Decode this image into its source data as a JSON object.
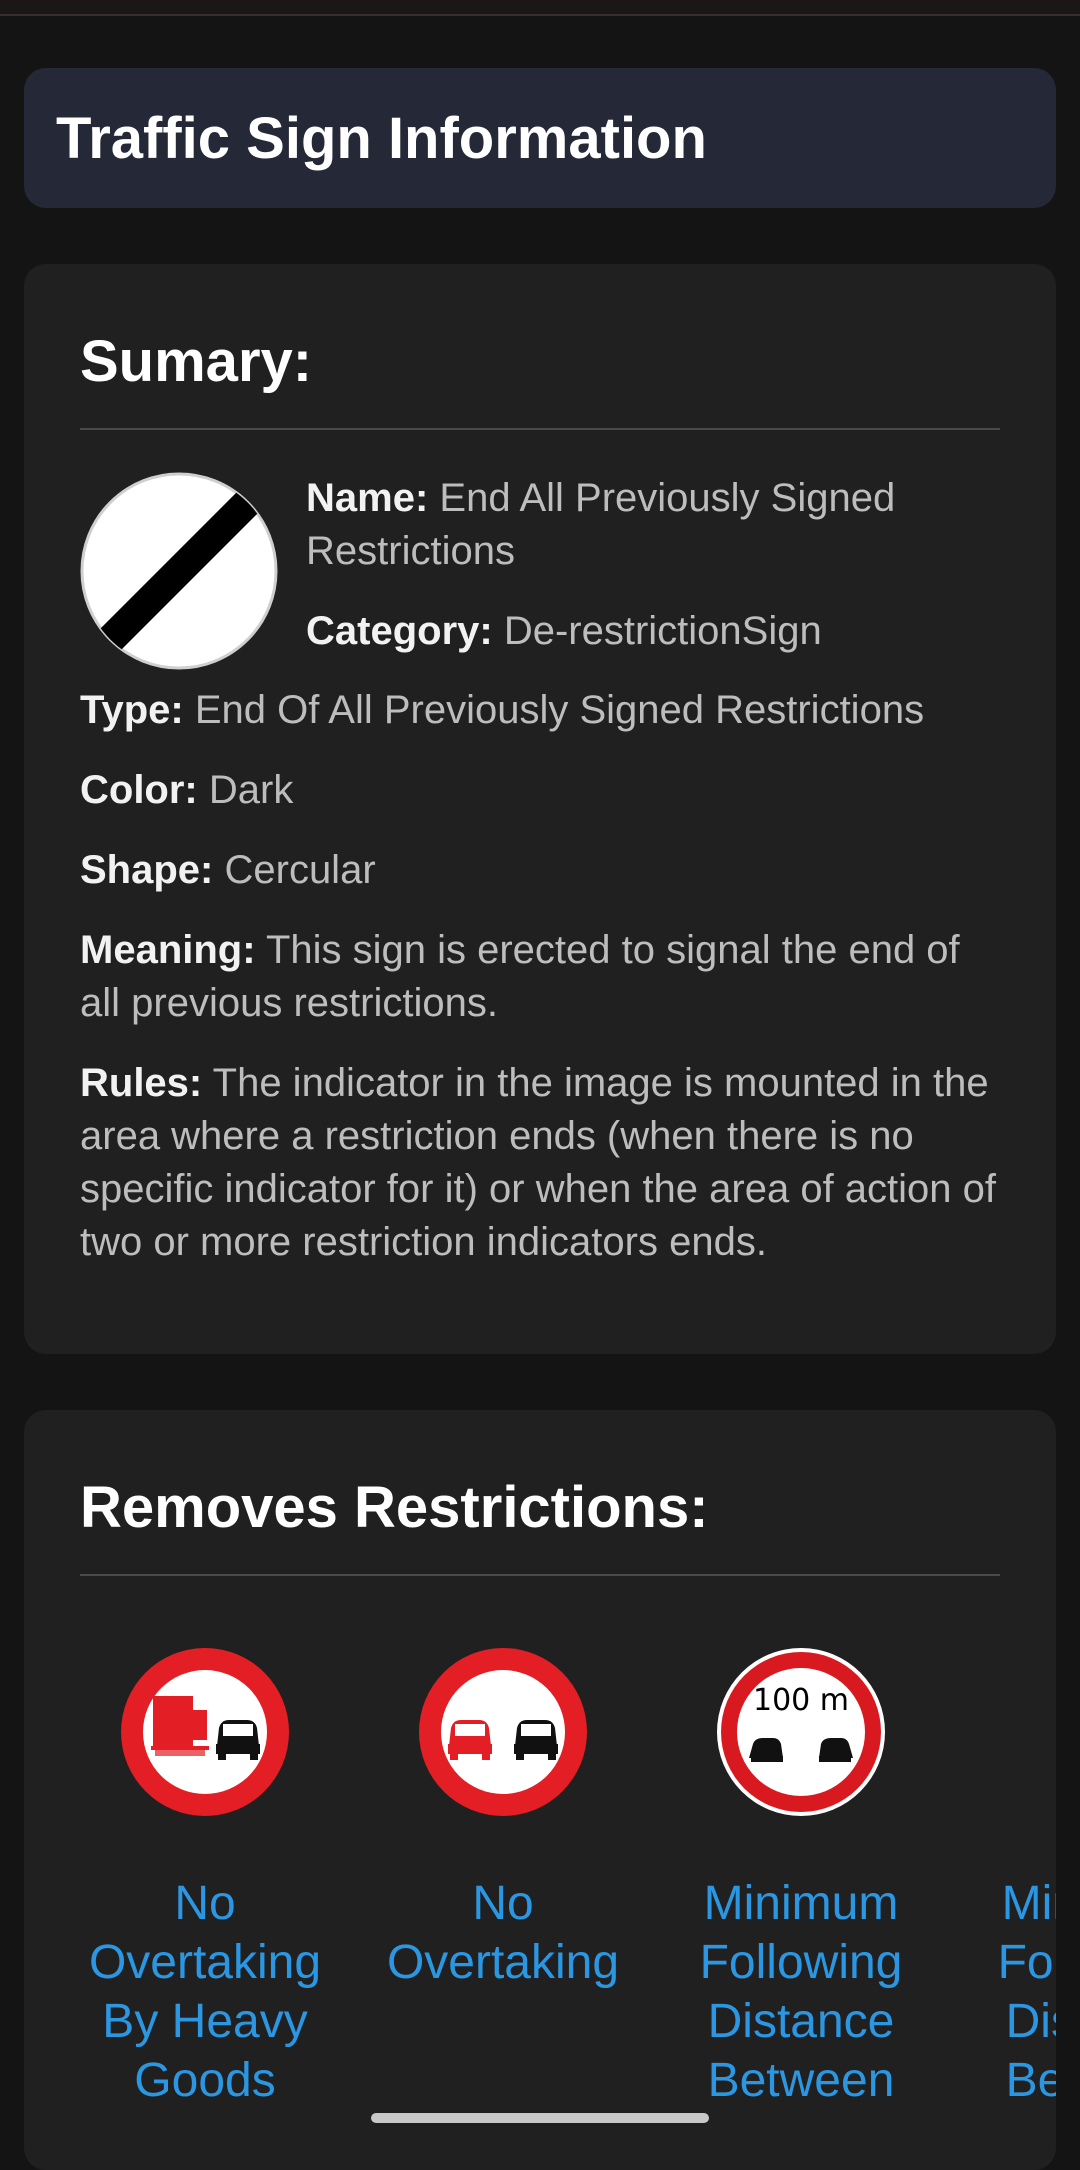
{
  "header": {
    "title": "Traffic Sign Information"
  },
  "summary": {
    "heading": "Sumary:",
    "sign_icon": "end-all-restrictions-sign-icon",
    "fields": [
      {
        "label": "Name:",
        "value": "End All Previously Signed Restrictions"
      },
      {
        "label": "Category:",
        "value": "De-restrictionSign"
      },
      {
        "label": "Type:",
        "value": "End Of All Previously Signed Restrictions"
      },
      {
        "label": "Color:",
        "value": "Dark"
      },
      {
        "label": "Shape:",
        "value": "Cercular"
      },
      {
        "label": "Meaning:",
        "value": "This sign is erected to signal the end of all previous restrictions."
      },
      {
        "label": "Rules:",
        "value": "The indicator in the image is mounted in the area where a restriction ends (when there is no specific indicator for it) or when the area of action of two or more restriction indicators ends."
      }
    ]
  },
  "restrictions": {
    "heading": "Removes Restrictions:",
    "items": [
      {
        "icon": "no-overtaking-heavy-goods-sign-icon",
        "label": "No Overtaking By Heavy Goods"
      },
      {
        "icon": "no-overtaking-sign-icon",
        "label": "No Overtaking"
      },
      {
        "icon": "minimum-following-distance-sign-icon",
        "sign_text": "100 m",
        "label": "Minimum Following Distance Between"
      },
      {
        "icon": "minimum-following-distance-sign-icon",
        "label": "Minimum Following Distance Between"
      }
    ]
  },
  "colors": {
    "link": "#2b97e3",
    "card": "#202020",
    "header_card": "#252837",
    "sign_red": "#e31e24"
  }
}
